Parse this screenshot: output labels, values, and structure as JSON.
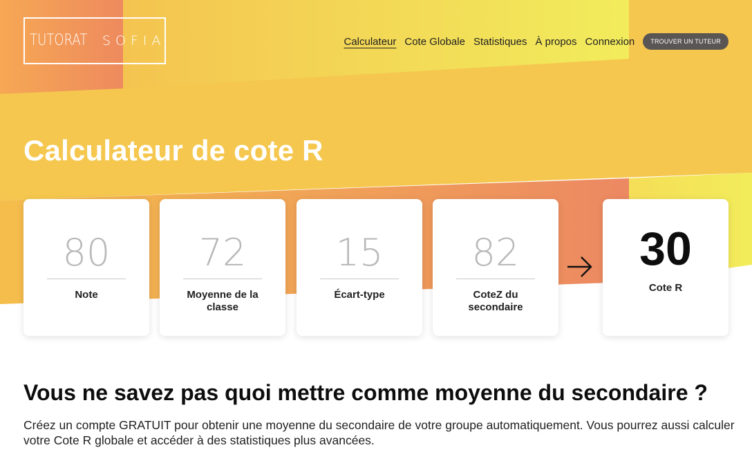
{
  "logo": {
    "left_word": "TUTORAT",
    "right_word": "SOFIA",
    "icon": "lightbulb-icon"
  },
  "nav": {
    "items": [
      {
        "label": "Calculateur",
        "active": true
      },
      {
        "label": "Cote Globale",
        "active": false
      },
      {
        "label": "Statistiques",
        "active": false
      },
      {
        "label": "À propos",
        "active": false
      },
      {
        "label": "Connexion",
        "active": false
      }
    ],
    "cta_label": "TROUVER UN TUTEUR"
  },
  "hero": {
    "title": "Calculateur de cote R"
  },
  "calculator": {
    "fields": [
      {
        "value": "80",
        "label": "Note"
      },
      {
        "value": "72",
        "label": "Moyenne de la classe"
      },
      {
        "value": "15",
        "label": "Écart-type"
      },
      {
        "value": "82",
        "label": "CoteZ du secondaire"
      }
    ],
    "arrow_icon": "arrow-right-icon",
    "result": {
      "value": "30",
      "label": "Cote R"
    }
  },
  "promo": {
    "title": "Vous ne savez pas quoi mettre comme moyenne du secondaire ?",
    "body": "Créez un compte GRATUIT pour obtenir une moyenne du secondaire de votre groupe automatiquement. Vous pourrez aussi calculer votre Cote R globale et accéder à des statistiques plus avancées."
  },
  "colors": {
    "yellow": "#F5C74E",
    "yellow_light": "#F3EA5C",
    "orange": "#EC8B62",
    "cta_bg": "#5A5654"
  }
}
